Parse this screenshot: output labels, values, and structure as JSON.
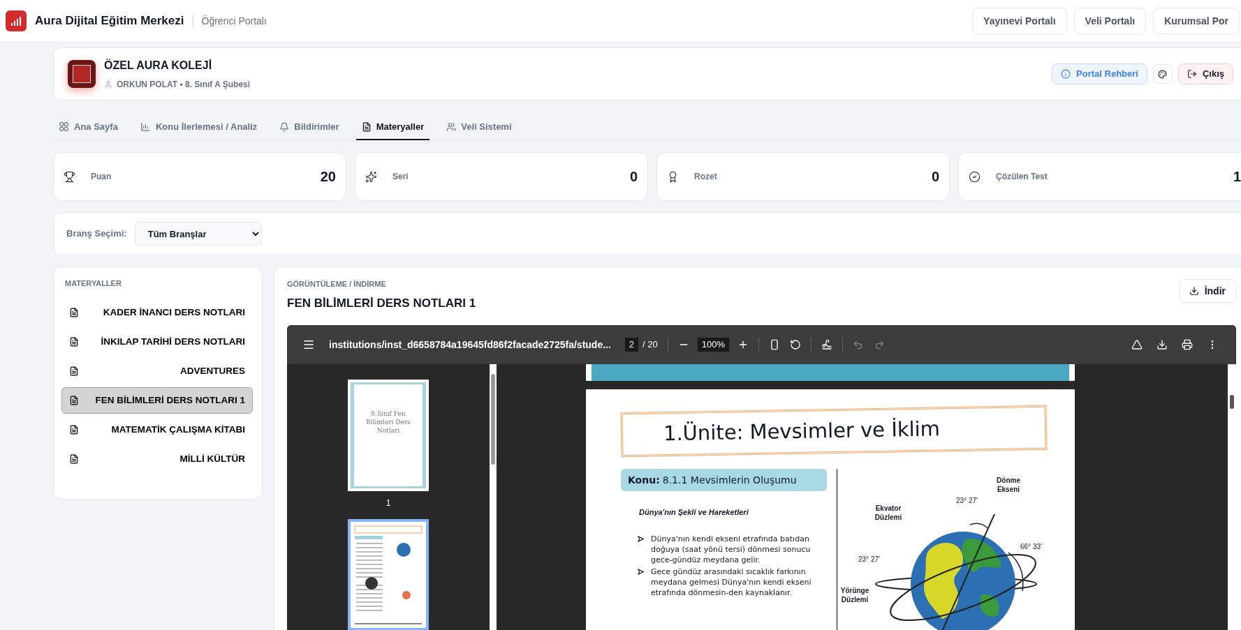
{
  "header": {
    "app_title": "Aura Dijital Eğitim Merkezi",
    "portal_label": "Öğrenci Portalı",
    "portal_links": [
      "Yayınevi Portalı",
      "Veli Portalı",
      "Kurumsal Por"
    ]
  },
  "profile": {
    "school": "ÖZEL AURA KOLEJİ",
    "student": "ORKUN POLAT • 8. Sınıf A Şubesi",
    "guide_button": "Portal Rehberi",
    "logout_button": "Çıkış"
  },
  "tabs": [
    {
      "label": "Ana Sayfa",
      "selected": false
    },
    {
      "label": "Konu İlerlemesi / Analiz",
      "selected": false
    },
    {
      "label": "Bildirimler",
      "selected": false
    },
    {
      "label": "Materyaller",
      "selected": true
    },
    {
      "label": "Veli Sistemi",
      "selected": false
    }
  ],
  "stats": [
    {
      "label": "Puan",
      "value": "20"
    },
    {
      "label": "Seri",
      "value": "0"
    },
    {
      "label": "Rozet",
      "value": "0"
    },
    {
      "label": "Çözülen Test",
      "value": "1"
    }
  ],
  "filter": {
    "label": "Branş Seçimi:",
    "value": "Tüm Branşlar"
  },
  "materials": {
    "heading": "MATERYALLER",
    "items": [
      {
        "title": "KADER İNANCI DERS NOTLARI",
        "selected": false
      },
      {
        "title": "İNKILAP TARİHİ DERS NOTLARI",
        "selected": false
      },
      {
        "title": "ADVENTURES",
        "selected": false
      },
      {
        "title": "FEN BİLİMLERİ DERS NOTLARI 1",
        "selected": true
      },
      {
        "title": "MATEMATİK ÇALIŞMA KİTABI",
        "selected": false
      },
      {
        "title": "MİLLİ KÜLTÜR",
        "selected": false
      }
    ]
  },
  "viewer": {
    "eyebrow": "GÖRÜNTÜLEME / İNDİRME",
    "title": "FEN BİLİMLERİ DERS NOTLARI 1",
    "download_button": "İndir",
    "pdf": {
      "file": "institutions/inst_d6658784a19645fd86f2facade2725fa/stude...",
      "page": "2",
      "pages": "/ 20",
      "zoom": "100%",
      "thumbnails": [
        {
          "page_label": "1",
          "selected": false,
          "cover_title": "8.Sınıf Fen Bilimleri Ders Notları"
        },
        {
          "selected": true
        }
      ],
      "document": {
        "unit_title": "1.Ünite: Mevsimler ve İklim",
        "topic_label": "Konu:",
        "topic": "8.1.1 Mevsimlerin Oluşumu",
        "section": "Dünya'nın Şekli ve Hareketleri",
        "bullets": [
          "Dünya'nın kendi ekseni etrafında batıdan doğuya (saat yönü tersi) dönmesi sonucu gece-gündüz meydana gelir.",
          "Gece gündüz arasındaki sıcaklık farkının meydana gelmesi Dünya'nın kendi ekseni etrafında dönmesin-den kaynaklanır."
        ],
        "figure_labels": {
          "axis": "Dönme Ekseni",
          "equator": "Ekvator Düzlemi",
          "tilt_top": "23° 27'",
          "angle": "66° 33'",
          "tilt_left": "23° 27'",
          "orbit": "Yörünge Düzlemi"
        }
      }
    }
  }
}
